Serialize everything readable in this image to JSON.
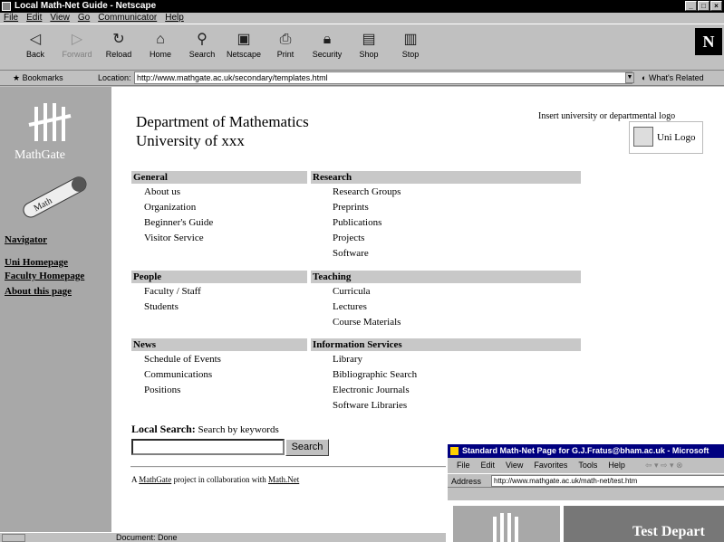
{
  "netscape": {
    "title": "Local Math-Net Guide - Netscape",
    "menu": [
      "File",
      "Edit",
      "View",
      "Go",
      "Communicator",
      "Help"
    ],
    "toolbar": [
      {
        "label": "Back",
        "icon": "back-icon",
        "disabled": false
      },
      {
        "label": "Forward",
        "icon": "forward-icon",
        "disabled": true
      },
      {
        "label": "Reload",
        "icon": "reload-icon",
        "disabled": false
      },
      {
        "label": "Home",
        "icon": "home-icon",
        "disabled": false
      },
      {
        "label": "Search",
        "icon": "search-icon",
        "disabled": false
      },
      {
        "label": "Netscape",
        "icon": "netscape-icon",
        "disabled": false
      },
      {
        "label": "Print",
        "icon": "print-icon",
        "disabled": false
      },
      {
        "label": "Security",
        "icon": "security-icon",
        "disabled": false
      },
      {
        "label": "Shop",
        "icon": "shop-icon",
        "disabled": false
      },
      {
        "label": "Stop",
        "icon": "stop-icon",
        "disabled": false
      }
    ],
    "bookmarks_label": "Bookmarks",
    "location_label": "Location:",
    "url": "http://www.mathgate.ac.uk/secondary/templates.html",
    "whats_related": "What's Related",
    "status": "Document: Done"
  },
  "page": {
    "brand": "MathGate",
    "sidebar_links": [
      "Navigator",
      "Uni Homepage",
      "Faculty Homepage",
      "About this page"
    ],
    "dept_line1": "Department of Mathematics",
    "dept_line2": "University of xxx",
    "insert_text": "Insert university or departmental logo",
    "uni_logo": "Uni Logo",
    "categories": [
      {
        "head": "General",
        "items": [
          "About us",
          "Organization",
          "Beginner's Guide",
          "Visitor Service"
        ]
      },
      {
        "head": "Research",
        "items": [
          "Research Groups",
          "Preprints",
          "Publications",
          "Projects",
          "Software"
        ]
      },
      {
        "head": "People",
        "items": [
          "Faculty / Staff",
          "Students"
        ]
      },
      {
        "head": "Teaching",
        "items": [
          "Curricula",
          "Lectures",
          "Course Materials"
        ]
      },
      {
        "head": "News",
        "items": [
          "Schedule of Events",
          "Communications",
          "Positions"
        ]
      },
      {
        "head": "Information Services",
        "items": [
          "Library",
          "Bibliographic Search",
          "Electronic Journals",
          "Software Libraries"
        ]
      }
    ],
    "search_title": "Local Search:",
    "search_hint": "Search by keywords",
    "search_value": "",
    "search_button": "Search",
    "footer_prefix": "A ",
    "footer_link1": "MathGate",
    "footer_middle": " project in collaboration with ",
    "footer_link2": "Math.Net"
  },
  "ie": {
    "title": "Standard Math-Net Page for G.J.Fratus@bham.ac.uk - Microsoft",
    "menu": [
      "File",
      "Edit",
      "View",
      "Favorites",
      "Tools",
      "Help"
    ],
    "address_label": "Address",
    "url": "http://www.mathgate.ac.uk/math-net/test.htm",
    "heading": "Test Depart"
  }
}
